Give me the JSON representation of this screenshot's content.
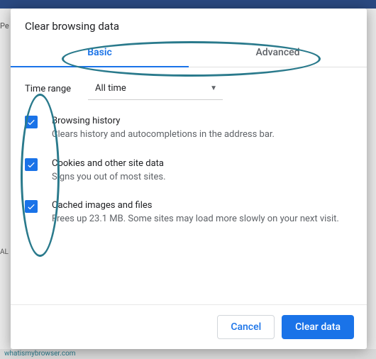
{
  "background": {
    "left_cut_text": "Pe",
    "left_cut_text2": "AL",
    "watermark": "whatismybrowser.com"
  },
  "dialog": {
    "title": "Clear browsing data",
    "tabs": {
      "basic": "Basic",
      "advanced": "Advanced"
    },
    "time_range": {
      "label": "Time range",
      "selected": "All time"
    },
    "options": [
      {
        "title": "Browsing history",
        "desc": "Clears history and autocompletions in the address bar.",
        "checked": true
      },
      {
        "title": "Cookies and other site data",
        "desc": "Signs you out of most sites.",
        "checked": true
      },
      {
        "title": "Cached images and files",
        "desc": "Frees up 23.1 MB. Some sites may load more slowly on your next visit.",
        "checked": true
      }
    ],
    "buttons": {
      "cancel": "Cancel",
      "clear": "Clear data"
    }
  },
  "annotation": {
    "color": "#2a7a8c"
  }
}
